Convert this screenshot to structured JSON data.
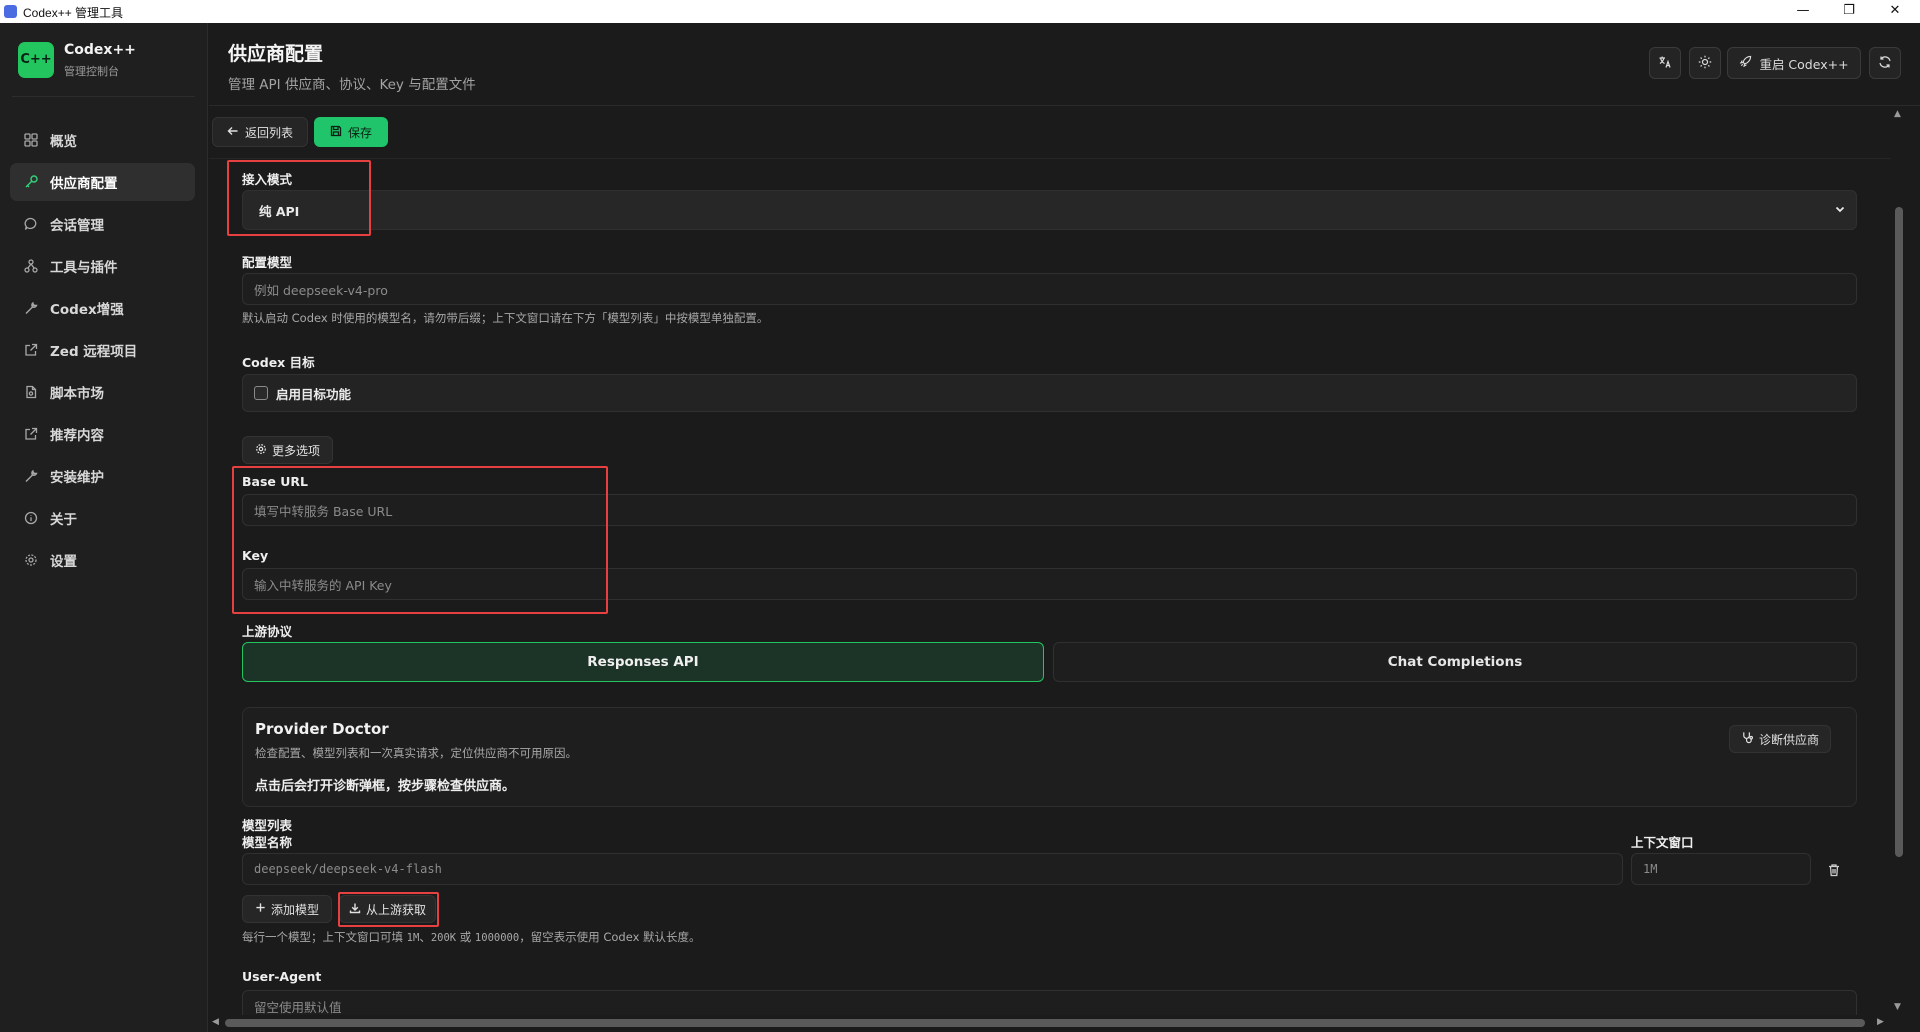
{
  "window": {
    "title": "Codex++ 管理工具"
  },
  "brand": {
    "logo_text": "C++",
    "name": "Codex++",
    "subtitle": "管理控制台"
  },
  "sidebar": {
    "items": [
      {
        "label": "概览",
        "icon": "grid-icon",
        "active": false
      },
      {
        "label": "供应商配置",
        "icon": "key-icon",
        "active": true
      },
      {
        "label": "会话管理",
        "icon": "chat-bubble-icon",
        "active": false
      },
      {
        "label": "工具与插件",
        "icon": "plugin-icon",
        "active": false
      },
      {
        "label": "Codex增强",
        "icon": "wrench-icon",
        "active": false
      },
      {
        "label": "Zed 远程项目",
        "icon": "external-link-icon",
        "active": false
      },
      {
        "label": "脚本市场",
        "icon": "script-file-icon",
        "active": false
      },
      {
        "label": "推荐内容",
        "icon": "external-link-icon",
        "active": false
      },
      {
        "label": "安装维护",
        "icon": "wrench-icon",
        "active": false
      },
      {
        "label": "关于",
        "icon": "info-icon",
        "active": false
      },
      {
        "label": "设置",
        "icon": "gear-icon",
        "active": false
      }
    ]
  },
  "header": {
    "title": "供应商配置",
    "subtitle": "管理 API 供应商、协议、Key 与配置文件",
    "restart_label": "重启 Codex++"
  },
  "actions": {
    "back_label": "返回列表",
    "save_label": "保存"
  },
  "form": {
    "access_mode": {
      "label": "接入模式",
      "value": "纯 API"
    },
    "model": {
      "label": "配置模型",
      "placeholder": "例如 deepseek-v4-pro",
      "hint": "默认启动 Codex 时使用的模型名，请勿带后缀；上下文窗口请在下方「模型列表」中按模型单独配置。"
    },
    "codex_goal": {
      "label": "Codex 目标",
      "checkbox_label": "启用目标功能",
      "checked": false
    },
    "more_options_label": "更多选项",
    "base_url": {
      "label": "Base URL",
      "placeholder": "填写中转服务 Base URL"
    },
    "key": {
      "label": "Key",
      "placeholder": "输入中转服务的 API Key"
    },
    "upstream_protocol": {
      "label": "上游协议",
      "options": [
        "Responses API",
        "Chat Completions"
      ],
      "selected": "Responses API"
    },
    "provider_doctor": {
      "title": "Provider Doctor",
      "description": "检查配置、模型列表和一次真实请求，定位供应商不可用原因。",
      "note": "点击后会打开诊断弹框，按步骤检查供应商。",
      "button_label": "诊断供应商"
    },
    "model_list": {
      "label": "模型列表",
      "name_header": "模型名称",
      "context_header": "上下文窗口",
      "rows": [
        {
          "name": "deepseek/deepseek-v4-flash",
          "context": "1M"
        }
      ],
      "add_label": "添加模型",
      "fetch_label": "从上游获取",
      "hint_prefix": "每行一个模型；上下文窗口可填 ",
      "hint_v1": "1M",
      "hint_sep1": "、",
      "hint_v2": "200K",
      "hint_sep2": " 或 ",
      "hint_v3": "1000000",
      "hint_suffix": "，留空表示使用 Codex 默认长度。"
    },
    "user_agent": {
      "label": "User-Agent",
      "placeholder": "留空使用默认值"
    }
  },
  "colors": {
    "accent": "#22c55e",
    "highlight": "#e74040",
    "background": "#1b1b1b"
  }
}
